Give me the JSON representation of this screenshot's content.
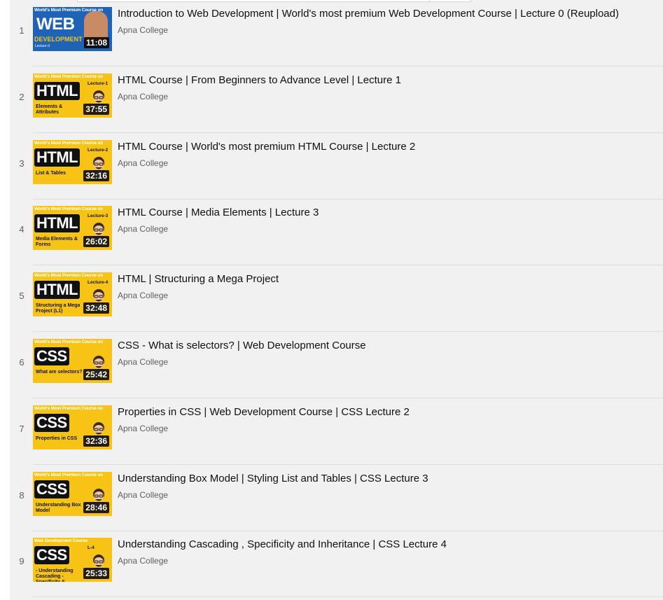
{
  "channel_name": "Apna College",
  "playlist": [
    {
      "index": "1",
      "title": "Introduction to Web Development | World's most premium Web Development Course | Lecture 0 (Reupload)",
      "duration": "11:08",
      "thumb": {
        "style": "web",
        "series": "World's Most Premium Course on",
        "badge": "WEB",
        "subtitle": "DEVELOPMENT",
        "lecture": "Lecture 0"
      }
    },
    {
      "index": "2",
      "title": "HTML Course | From Beginners to Advance Level | Lecture 1",
      "duration": "37:55",
      "thumb": {
        "style": "html",
        "series": "World's Most Premium Course on",
        "badge": "HTML",
        "subtitle": "Elements & Attributes",
        "lecture": "Lecture-1"
      }
    },
    {
      "index": "3",
      "title": "HTML Course | World's most premium HTML Course | Lecture 2",
      "duration": "32:16",
      "thumb": {
        "style": "html",
        "series": "World's Most Premium Course on",
        "badge": "HTML",
        "subtitle": "List & Tables",
        "lecture": "Lecture-2"
      }
    },
    {
      "index": "4",
      "title": "HTML Course | Media Elements | Lecture 3",
      "duration": "26:02",
      "thumb": {
        "style": "html",
        "series": "World's Most Premium Course on",
        "badge": "HTML",
        "subtitle": "Media Elements & Forms",
        "lecture": "Lecture-3"
      }
    },
    {
      "index": "5",
      "title": "HTML | Structuring a Mega Project",
      "duration": "32:48",
      "thumb": {
        "style": "html",
        "series": "World's Most Premium Course on",
        "badge": "HTML",
        "subtitle": "Structuring a Mega Project (L1)",
        "lecture": "Lecture-4"
      }
    },
    {
      "index": "6",
      "title": "CSS - What is selectors? | Web Development Course",
      "duration": "25:42",
      "thumb": {
        "style": "css",
        "series": "World's Most Premium Course on",
        "badge": "CSS",
        "subtitle": "What are selectors?",
        "lecture": ""
      }
    },
    {
      "index": "7",
      "title": "Properties in CSS | Web Development Course | CSS Lecture 2",
      "duration": "32:36",
      "thumb": {
        "style": "css",
        "series": "World's Most Premium Course on",
        "badge": "CSS",
        "subtitle": "Properties in CSS",
        "lecture": ""
      }
    },
    {
      "index": "8",
      "title": "Understanding Box Model | Styling List and Tables | CSS Lecture 3",
      "duration": "28:46",
      "thumb": {
        "style": "css",
        "series": "World's Most Premium Course on",
        "badge": "CSS",
        "subtitle": "Understanding Box Model",
        "lecture": ""
      }
    },
    {
      "index": "9",
      "title": "Understanding Cascading , Specificity and Inheritance | CSS Lecture 4",
      "duration": "25:33",
      "thumb": {
        "style": "css",
        "series": "Web Development Course",
        "badge": "CSS",
        "subtitle": "- Understanding Cascading - Specificity & Inheritance",
        "lecture": "L-4"
      }
    }
  ]
}
